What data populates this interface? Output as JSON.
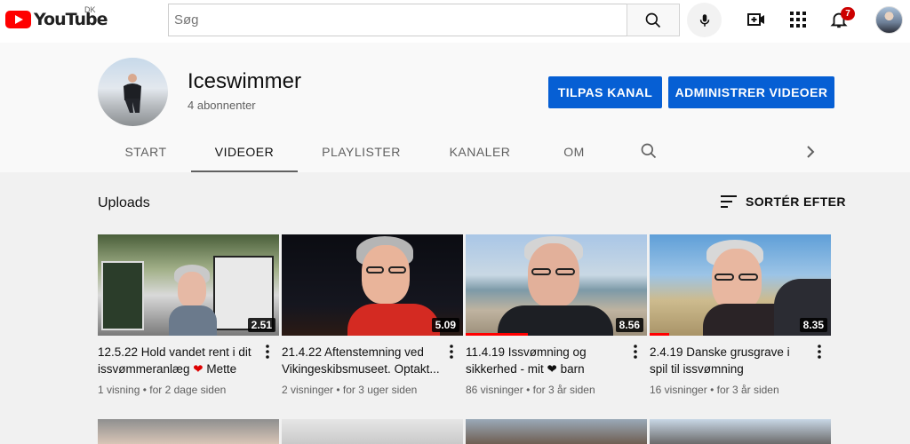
{
  "header": {
    "logo_text": "YouTube",
    "logo_country": "DK",
    "search_placeholder": "Søg",
    "notification_count": "7",
    "icons": [
      "youtube-logo-icon",
      "search-icon",
      "mic-icon",
      "create-video-icon",
      "apps-grid-icon",
      "bell-icon"
    ]
  },
  "channel": {
    "name": "Iceswimmer",
    "subscribers": "4 abonnenter",
    "customize_label": "TILPAS KANAL",
    "manage_label": "ADMINISTRER VIDEOER"
  },
  "tabs": [
    {
      "label": "START"
    },
    {
      "label": "VIDEOER"
    },
    {
      "label": "PLAYLISTER"
    },
    {
      "label": "KANALER"
    },
    {
      "label": "OM"
    }
  ],
  "active_tab": "VIDEOER",
  "section": {
    "title": "Uploads",
    "sort_label": "SORTÉR EFTER"
  },
  "videos": [
    {
      "title_before": "12.5.22 Hold vandet rent i dit issvømmeranlæg ",
      "title_after": " Mette",
      "duration": "2.51",
      "views": "1 visning",
      "age": "for 2 dage siden"
    },
    {
      "title": "21.4.22 Aftenstemning ved Vikingeskibsmuseet. Optakt...",
      "duration": "5.09",
      "views": "2 visninger",
      "age": "for 3 uger siden"
    },
    {
      "title_before": "11.4.19 Issvømning og sikkerhed - mit ",
      "title_after": " barn",
      "duration": "8.56",
      "views": "86 visninger",
      "age": "for 3 år siden"
    },
    {
      "title": "2.4.19 Danske grusgrave i spil til issvømning",
      "duration": "8.35",
      "views": "16 visninger",
      "age": "for 3 år siden"
    }
  ],
  "meta_separator": "•",
  "colors": {
    "brand_red": "#ff0000",
    "button_blue": "#065fd4",
    "badge_red": "#cc0000"
  }
}
